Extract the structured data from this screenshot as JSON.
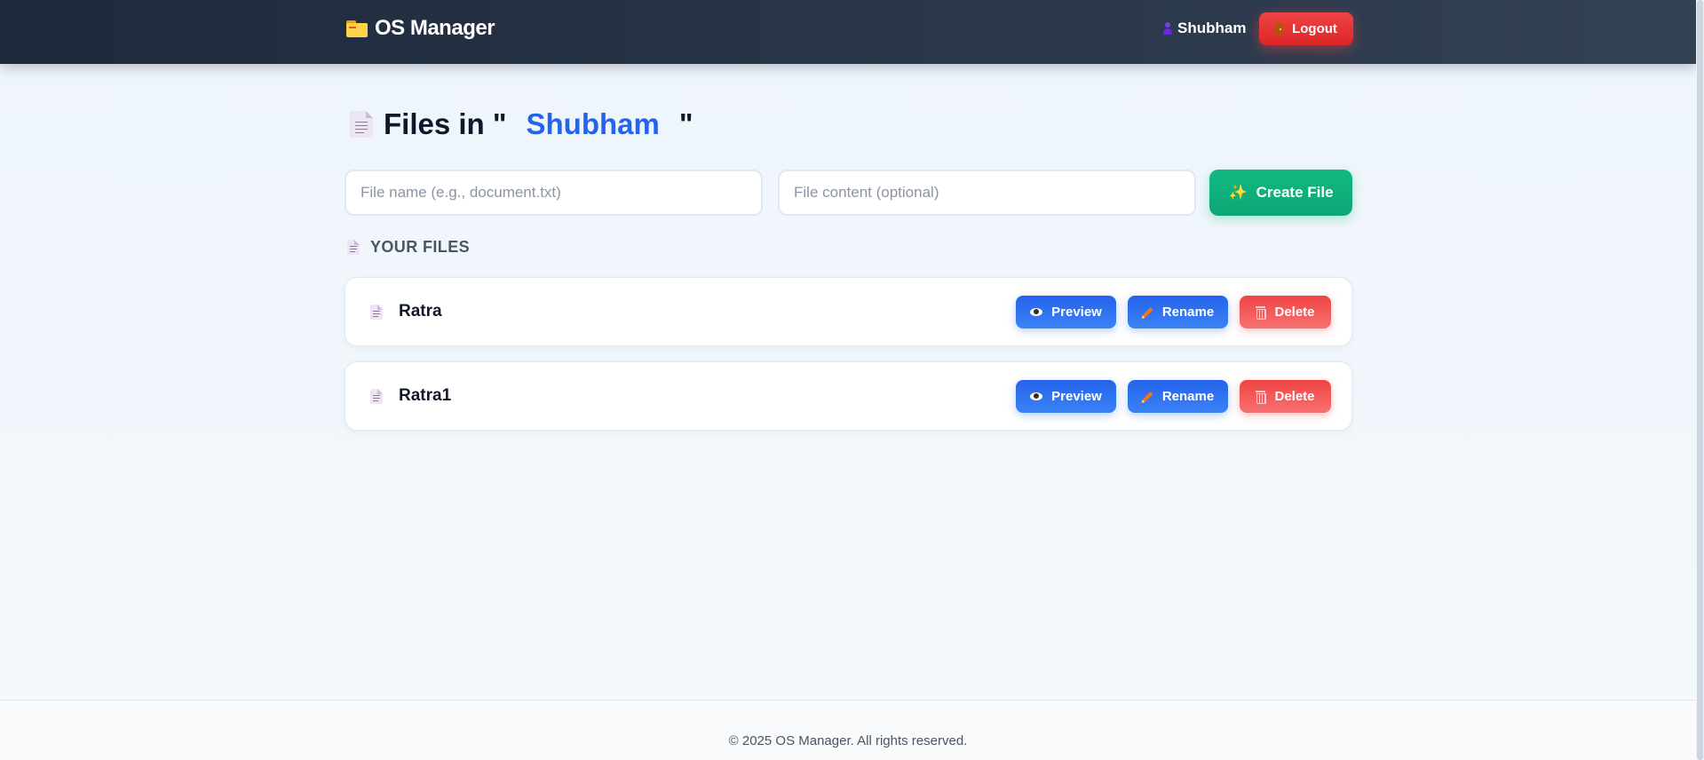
{
  "navbar": {
    "brand": "OS Manager",
    "brand_icon": "folder-icon",
    "user_icon": "user-icon",
    "username": "Shubham",
    "logout_label": "Logout",
    "logout_icon": "door-icon"
  },
  "header": {
    "title_prefix": "Files in \"",
    "folder_name": "Shubham",
    "title_suffix": "\"",
    "title_icon": "document-icon"
  },
  "create_form": {
    "name_value": "",
    "name_placeholder": "File name (e.g., document.txt)",
    "content_value": "",
    "content_placeholder": "File content (optional)",
    "create_label": "Create File",
    "create_icon": "sparkle-icon"
  },
  "files_section": {
    "label": "YOUR FILES",
    "icon": "document-icon"
  },
  "files": [
    {
      "name": "Ratra",
      "preview_label": "Preview",
      "rename_label": "Rename",
      "delete_label": "Delete"
    },
    {
      "name": "Ratra1",
      "preview_label": "Preview",
      "rename_label": "Rename",
      "delete_label": "Delete"
    }
  ],
  "footer": {
    "text": "© 2025 OS Manager. All rights reserved."
  },
  "colors": {
    "navbar_bg": "#1e293b",
    "accent_blue": "#2563eb",
    "success_green": "#10b981",
    "danger_red": "#ef4444"
  }
}
